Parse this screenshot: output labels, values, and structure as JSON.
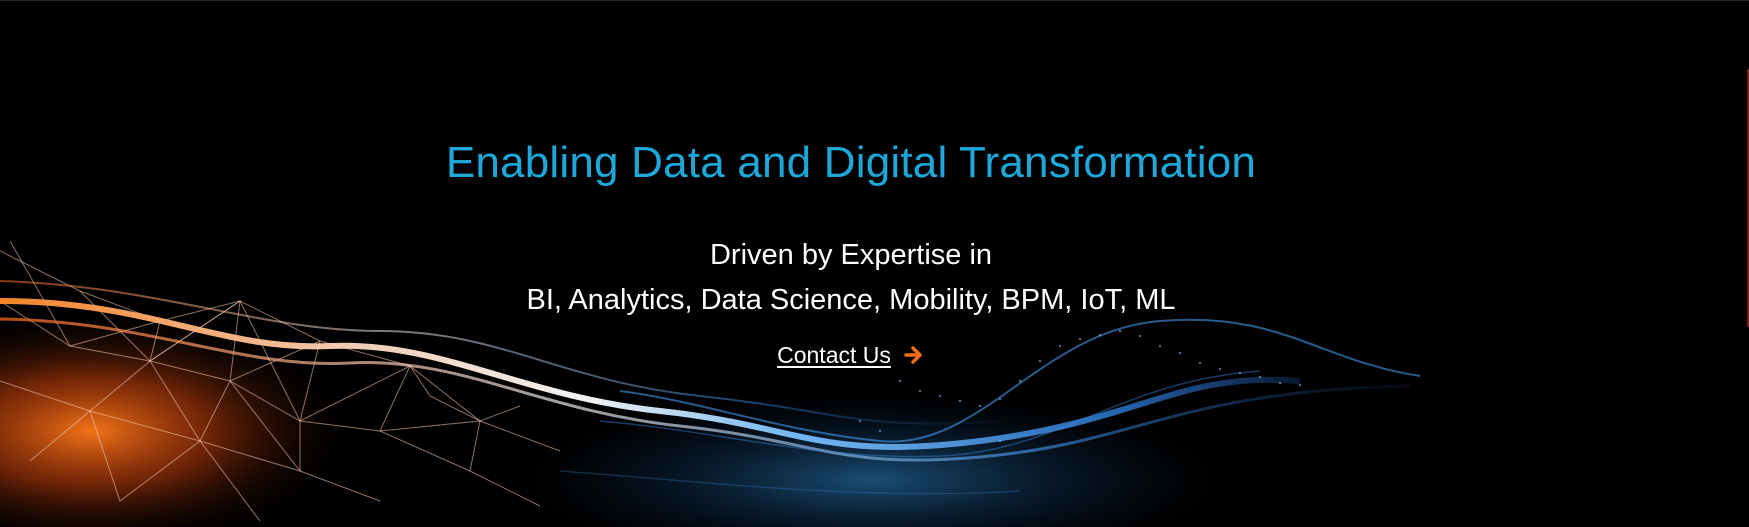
{
  "hero": {
    "headline": "Enabling Data and Digital Transformation",
    "subheading_line1": "Driven by Expertise in",
    "subheading_line2": "BI, Analytics, Data Science, Mobility, BPM, IoT, ML",
    "cta_label": "Contact Us",
    "cta_icon": "arrow-right-icon"
  },
  "colors": {
    "background": "#000000",
    "headline": "#1ea8d9",
    "text": "#ffffff",
    "accent_orange": "#f26a1b",
    "wave_blue": "#2f8fd8"
  }
}
